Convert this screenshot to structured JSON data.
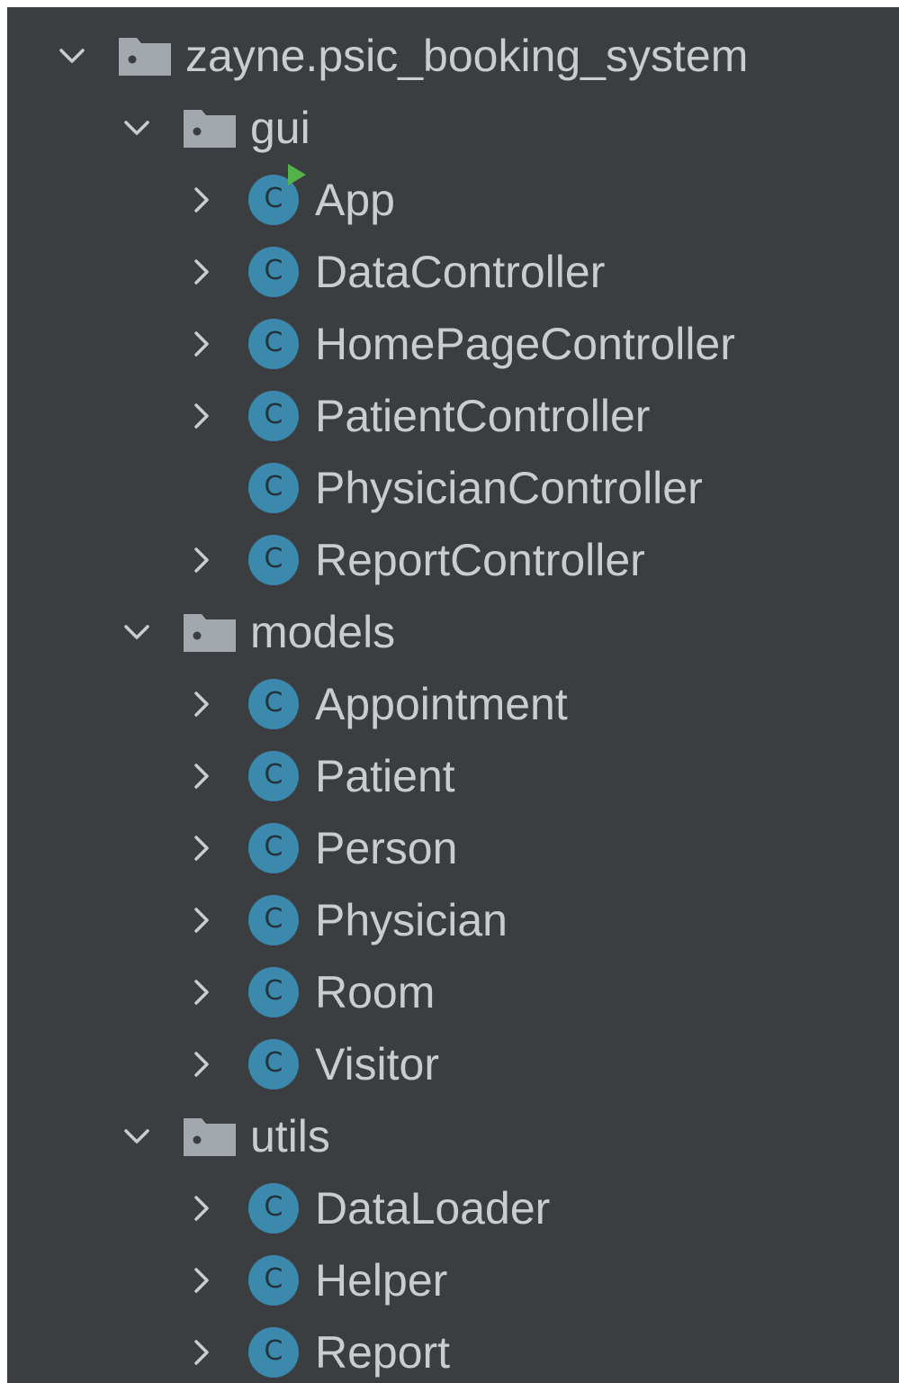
{
  "colors": {
    "panel_background": "#3b3e41",
    "text": "#c9ccd0",
    "class_icon": "#3b89ad",
    "run_marker": "#55b14a"
  },
  "icons": {
    "expanded": "chevron-down-icon",
    "collapsed": "chevron-right-icon",
    "package": "package-folder-icon",
    "class": "class-icon",
    "class_glyph": "C",
    "runnable": "run-marker-icon"
  },
  "tree": {
    "root": {
      "label": "zayne.psic_booking_system",
      "expanded": true
    },
    "packages": [
      {
        "label": "gui",
        "expanded": true,
        "classes": [
          {
            "label": "App",
            "expandable": true,
            "runnable": true
          },
          {
            "label": "DataController",
            "expandable": true
          },
          {
            "label": "HomePageController",
            "expandable": true
          },
          {
            "label": "PatientController",
            "expandable": true
          },
          {
            "label": "PhysicianController",
            "expandable": false
          },
          {
            "label": "ReportController",
            "expandable": true
          }
        ]
      },
      {
        "label": "models",
        "expanded": true,
        "classes": [
          {
            "label": "Appointment",
            "expandable": true
          },
          {
            "label": "Patient",
            "expandable": true
          },
          {
            "label": "Person",
            "expandable": true
          },
          {
            "label": "Physician",
            "expandable": true
          },
          {
            "label": "Room",
            "expandable": true
          },
          {
            "label": "Visitor",
            "expandable": true
          }
        ]
      },
      {
        "label": "utils",
        "expanded": true,
        "classes": [
          {
            "label": "DataLoader",
            "expandable": true
          },
          {
            "label": "Helper",
            "expandable": true
          },
          {
            "label": "Report",
            "expandable": true
          }
        ]
      }
    ]
  }
}
